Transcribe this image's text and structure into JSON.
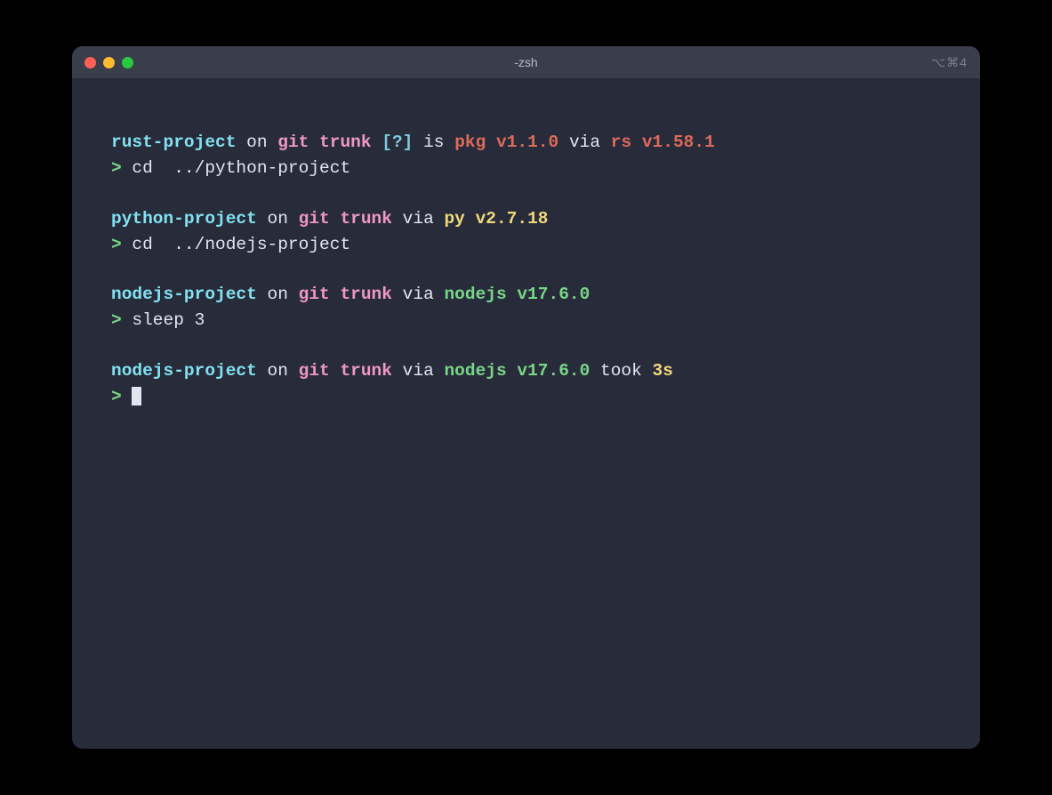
{
  "window": {
    "title": "-zsh",
    "shortcut_hint": "⌥⌘4"
  },
  "blocks": [
    {
      "dir": "rust-project",
      "on": "on",
      "git": "git",
      "branch": "trunk",
      "status": "[?]",
      "is": "is",
      "pkg": "pkg",
      "pkgver": "v1.1.0",
      "via": "via",
      "rt": "rs",
      "rtver": "v1.58.1",
      "chevron": ">",
      "cmd": "cd  ../python-project"
    },
    {
      "dir": "python-project",
      "on": "on",
      "git": "git",
      "branch": "trunk",
      "via": "via",
      "rt": "py",
      "rtver": "v2.7.18",
      "chevron": ">",
      "cmd": "cd  ../nodejs-project"
    },
    {
      "dir": "nodejs-project",
      "on": "on",
      "git": "git",
      "branch": "trunk",
      "via": "via",
      "rt": "nodejs",
      "rtver": "v17.6.0",
      "chevron": ">",
      "cmd": "sleep 3"
    },
    {
      "dir": "nodejs-project",
      "on": "on",
      "git": "git",
      "branch": "trunk",
      "via": "via",
      "rt": "nodejs",
      "rtver": "v17.6.0",
      "took": "took",
      "dur": "3s",
      "chevron": ">",
      "cmd": ""
    }
  ]
}
